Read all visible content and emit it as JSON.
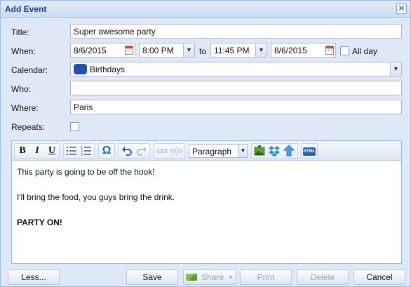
{
  "window": {
    "title": "Add Event"
  },
  "form": {
    "title_label": "Title:",
    "title_value": "Super awesome party",
    "when_label": "When:",
    "start_date": "8/6/2015",
    "start_time": "8:00 PM",
    "to_label": "to",
    "end_time": "11:45 PM",
    "end_date": "8/6/2015",
    "all_day_label": "All day",
    "all_day_checked": false,
    "calendar_label": "Calendar:",
    "calendar_value": "Birthdays",
    "calendar_color": "#2050b8",
    "who_label": "Who:",
    "who_value": "",
    "where_label": "Where:",
    "where_value": "Paris",
    "repeats_label": "Repeats:",
    "repeats_checked": false
  },
  "editor": {
    "toolbar": {
      "bold": "B",
      "italic": "I",
      "underline": "U",
      "format_value": "Paragraph",
      "icons": [
        "bullet-list-icon",
        "numbered-list-icon",
        "omega-icon",
        "undo-icon",
        "redo-icon",
        "link-icon",
        "unlink-icon",
        "insert-image-icon",
        "dropbox-icon",
        "upload-icon",
        "html-icon"
      ],
      "html_label": "HTML"
    },
    "content": {
      "line1": "This party is going to be off the hook!",
      "line2": "I'll bring the food, you guys bring the drink.",
      "line3": "PARTY ON!"
    }
  },
  "buttons": {
    "less": "Less...",
    "save": "Save",
    "share": "Share",
    "print": "Print",
    "delete": "Delete",
    "cancel": "Cancel"
  },
  "colors": {
    "accent": "#15428b",
    "border": "#99bbe8",
    "background": "#dfe8f6"
  }
}
